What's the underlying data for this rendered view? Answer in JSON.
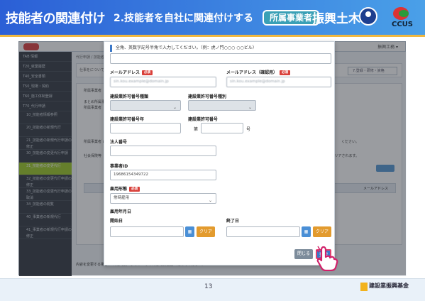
{
  "banner": {
    "title": "技能者の関連付け",
    "subtitle": "2.技能者を自社に関連付けする",
    "role_tag": "所属事業者",
    "company": "振興土木",
    "brand_text": "CCUS"
  },
  "app": {
    "user_menu": "振興工務 ▾",
    "breadcrumb": "代行申請 / 技能者",
    "panel_text": "仕事をについて",
    "step_label": "7.登録・研修・資格",
    "bg_lines": [
      "所属事業者",
      "まとめ所属事業者",
      "所属事業者",
      "所属事業者 の",
      "社会保険等"
    ],
    "bg_hint_1": "ください。",
    "bg_hint_2": "クリアされます。",
    "table_col": "メールアドレス",
    "footer_note": "内容を変更する場合、「内容確認へ」ボタンより内容確認画面へ進んでください。",
    "sidebar": [
      {
        "label": "TAB 情報",
        "sub": false
      },
      {
        "label": "T20_就業履歴",
        "sub": false
      },
      {
        "label": "T40_安全書類",
        "sub": false
      },
      {
        "label": "T50_現場・契約",
        "sub": false
      },
      {
        "label": "T60_施工体制登録",
        "sub": false
      },
      {
        "label": "T70_代行申請",
        "sub": false
      },
      {
        "label": "10_技能者情報参照",
        "sub": true
      },
      {
        "label": "20_技能者の新規代行",
        "sub": true
      },
      {
        "label": "21_技能者の新規代行申請の修正",
        "sub": true
      },
      {
        "label": "30_技能者の変更代行申請",
        "sub": true
      },
      {
        "label": "31_技能者の変更代行",
        "sub": true,
        "active": true
      },
      {
        "label": "32_技能者の変更代行申請の修正",
        "sub": true
      },
      {
        "label": "33_技能者の変更代行申請の取消",
        "sub": true
      },
      {
        "label": "34_技能者の閲覧",
        "sub": true
      },
      {
        "label": "40_事業者の新規代行",
        "sub": true
      },
      {
        "label": "41_事業者の新規代行申請の修正",
        "sub": true
      }
    ]
  },
  "modal": {
    "note": "全角、英数字記号半角で入力してください。（例：虎ノ門○○○ ○○ビル）",
    "email_label": "メールアドレス",
    "email_required": "必須",
    "email_value": "sin.kou.example@domain.jp",
    "email_confirm_label": "メールアドレス（確認用）",
    "email_confirm_required": "必須",
    "email_confirm_value": "sin.kou.example@domain.jp",
    "license_type_label": "建設業許可番号種類",
    "license_kind_label": "建設業許可番号種別",
    "license_year_label": "建設業許可番号年",
    "license_number_label": "建設業許可番号",
    "dai_label": "第",
    "go_label": "号",
    "corp_number_label": "法人番号",
    "business_id_label": "事業者ID",
    "business_id_value": "19686154349722",
    "employment_label": "雇用形態",
    "employment_required": "必須",
    "employment_value": "常時雇用",
    "employment_date_label": "雇用年月日",
    "start_date_label": "開始日",
    "end_date_label": "終了日",
    "clear_label": "クリア",
    "close_label": "閉じる",
    "register_label": "登録"
  },
  "footer": {
    "page": "13",
    "org": "建設業振興基金"
  }
}
